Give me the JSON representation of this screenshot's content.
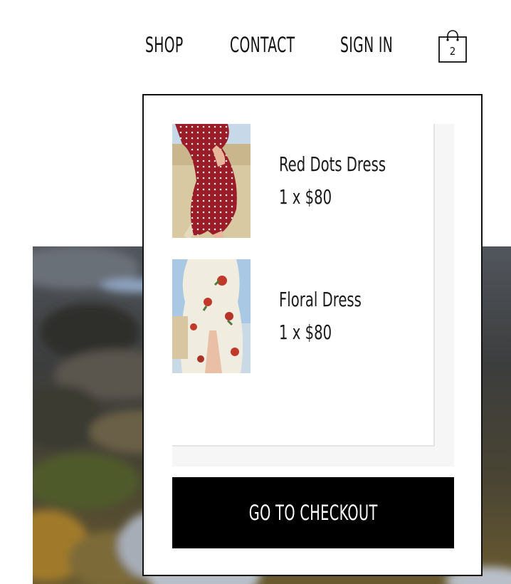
{
  "nav": {
    "links": [
      {
        "label": "SHOP"
      },
      {
        "label": "CONTACT"
      },
      {
        "label": "SIGN IN"
      }
    ],
    "cart": {
      "icon": "shopping-bag-icon",
      "count": "2"
    }
  },
  "cart_dropdown": {
    "items": [
      {
        "name": "Red Dots Dress",
        "quantity_price": "1 x $80",
        "image": "red-polka-dot-dress-photo"
      },
      {
        "name": "Floral Dress",
        "quantity_price": "1 x $80",
        "image": "floral-wrap-dress-photo"
      }
    ],
    "checkout_label": "GO TO CHECKOUT"
  },
  "hero": {
    "image": "mountain-landscape-photo"
  }
}
